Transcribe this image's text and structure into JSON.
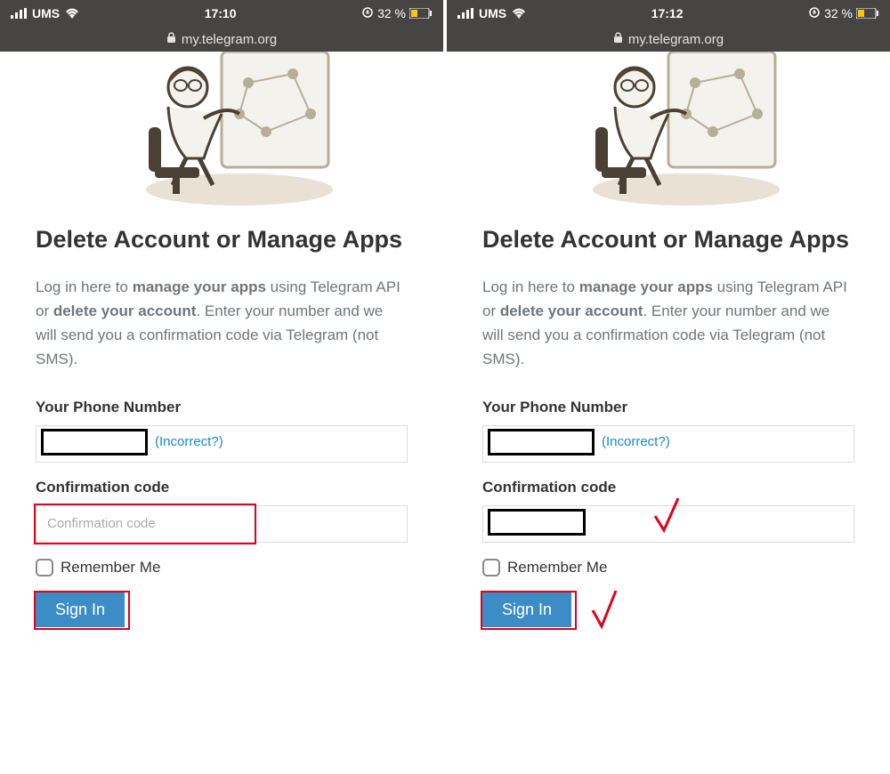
{
  "left": {
    "status": {
      "carrier": "UMS",
      "time": "17:10",
      "battery_pct": "32 %"
    },
    "address_bar": {
      "url": "my.telegram.org"
    },
    "page": {
      "heading": "Delete Account or Manage Apps",
      "description_pre": "Log in here to ",
      "description_bold1": "manage your apps",
      "description_mid": " using Telegram API or ",
      "description_bold2": "delete your account",
      "description_post": ". Enter your number and we will send you a confirmation code via Telegram (not SMS).",
      "phone_label": "Your Phone Number",
      "incorrect_link": "(Incorrect?)",
      "code_label": "Confirmation code",
      "code_placeholder": "Confirmation code",
      "remember_label": "Remember Me",
      "signin_label": "Sign In"
    }
  },
  "right": {
    "status": {
      "carrier": "UMS",
      "time": "17:12",
      "battery_pct": "32 %"
    },
    "address_bar": {
      "url": "my.telegram.org"
    },
    "page": {
      "heading": "Delete Account or Manage Apps",
      "description_pre": "Log in here to ",
      "description_bold1": "manage your apps",
      "description_mid": " using Telegram API or ",
      "description_bold2": "delete your account",
      "description_post": ". Enter your number and we will send you a confirmation code via Telegram (not SMS).",
      "phone_label": "Your Phone Number",
      "incorrect_link": "(Incorrect?)",
      "code_label": "Confirmation code",
      "remember_label": "Remember Me",
      "signin_label": "Sign In"
    }
  },
  "icons": {
    "lock": "lock-icon",
    "rotation_lock": "rotation-lock-icon"
  }
}
